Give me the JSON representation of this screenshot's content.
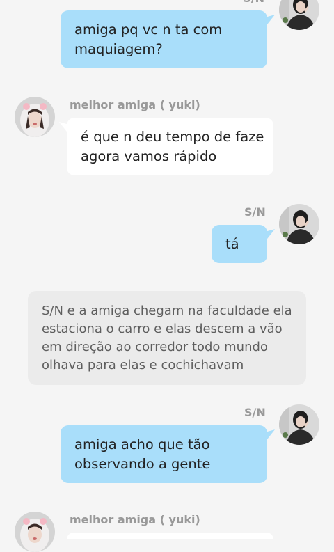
{
  "participants": {
    "me": "S/N",
    "friend": "melhor amiga ( yuki)"
  },
  "messages": [
    {
      "from": "me",
      "lines": [
        "amiga pq vc n ta com",
        "maquiagem?"
      ]
    },
    {
      "from": "friend",
      "lines": [
        "é que n deu tempo de faze",
        "agora vamos rápido"
      ]
    },
    {
      "from": "me",
      "lines": [
        "tá"
      ]
    },
    {
      "from": "me",
      "lines": [
        "amiga acho que tão",
        "observando a gente"
      ]
    }
  ],
  "narration": {
    "lines": [
      "S/N e a amiga chegam na faculdade ela",
      "estaciona o carro e elas  descem  a vão",
      "em direção ao corredor todo mundo",
      "olhava para elas e cochichavam"
    ]
  },
  "colors": {
    "background": "#f5f5f5",
    "my_bubble": "#a9defa",
    "friend_bubble": "#ffffff",
    "narration_bg": "#ebebeb",
    "sender_name": "#999999"
  },
  "icons": {
    "my_avatar": "dark-haired-person-avatar-icon",
    "friend_avatar": "girl-with-bunny-ears-avatar-icon"
  }
}
